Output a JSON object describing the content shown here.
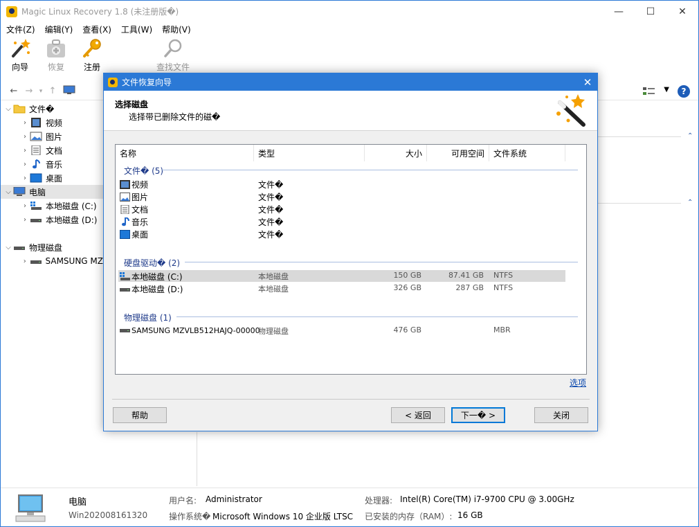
{
  "window": {
    "title": "Magic Linux Recovery 1.8 (未注册版�)",
    "controls": [
      "—",
      "☐",
      "✕"
    ]
  },
  "menu": [
    "文件(Z)",
    "编辑(Y)",
    "查看(X)",
    "工具(W)",
    "帮助(V)"
  ],
  "toolbar": {
    "wizard": "向导",
    "recover": "恢复",
    "register": "注册",
    "find_file": "查找文件"
  },
  "tree": {
    "files_root": "文件�",
    "files": [
      "视频",
      "图片",
      "文档",
      "音乐",
      "桌面"
    ],
    "computer": "电脑",
    "drives": [
      "本地磁盘 (C:)",
      "本地磁盘 (D:)"
    ],
    "physical_root": "物理磁盘",
    "physical": [
      "SAMSUNG MZ"
    ]
  },
  "status": {
    "computer_label": "电脑",
    "computer_name": "Win202008161320",
    "user_label": "用户名:",
    "user_value": "Administrator",
    "os_label": "操作系统�",
    "os_value": "Microsoft Windows 10 企业版 LTSC",
    "cpu_label": "处理器:",
    "cpu_value": "Intel(R) Core(TM) i7-9700 CPU @ 3.00GHz",
    "ram_label": "已安装的内存（RAM）:",
    "ram_value": "16 GB"
  },
  "dialog": {
    "title": "文件恢复向导",
    "heading": "选择磁盘",
    "subheading": "选择带已删除文件的磁�",
    "columns": [
      "名称",
      "类型",
      "大小",
      "可用空间",
      "文件系统"
    ],
    "groups": [
      {
        "label": "文件� (5)",
        "rows": [
          {
            "icon": "video",
            "name": "视频",
            "type": "文件�",
            "size": "",
            "free": "",
            "fs": ""
          },
          {
            "icon": "picture",
            "name": "图片",
            "type": "文件�",
            "size": "",
            "free": "",
            "fs": ""
          },
          {
            "icon": "document",
            "name": "文档",
            "type": "文件�",
            "size": "",
            "free": "",
            "fs": ""
          },
          {
            "icon": "music",
            "name": "音乐",
            "type": "文件�",
            "size": "",
            "free": "",
            "fs": ""
          },
          {
            "icon": "desktop",
            "name": "桌面",
            "type": "文件�",
            "size": "",
            "free": "",
            "fs": ""
          }
        ]
      },
      {
        "label": "硬盘驱动� (2)",
        "rows": [
          {
            "icon": "windows-drive",
            "name": "本地磁盘 (C:)",
            "type": "本地磁盘",
            "size": "150 GB",
            "free": "87.41 GB",
            "fs": "NTFS",
            "selected": true
          },
          {
            "icon": "drive",
            "name": "本地磁盘 (D:)",
            "type": "本地磁盘",
            "size": "326 GB",
            "free": "287 GB",
            "fs": "NTFS"
          }
        ]
      },
      {
        "label": "物理磁盘 (1)",
        "rows": [
          {
            "icon": "drive",
            "name": "SAMSUNG MZVLB512HAJQ-00000",
            "type": "物理磁盘",
            "size": "476 GB",
            "free": "",
            "fs": "MBR"
          }
        ]
      }
    ],
    "options_link": "选项",
    "buttons": {
      "help": "帮助",
      "back": "< 返回",
      "next": "下一� >",
      "close": "关闭"
    }
  },
  "colors": {
    "accent": "#2b79d6",
    "group_text": "#1e3a8a",
    "selection": "#d9d9d9"
  }
}
